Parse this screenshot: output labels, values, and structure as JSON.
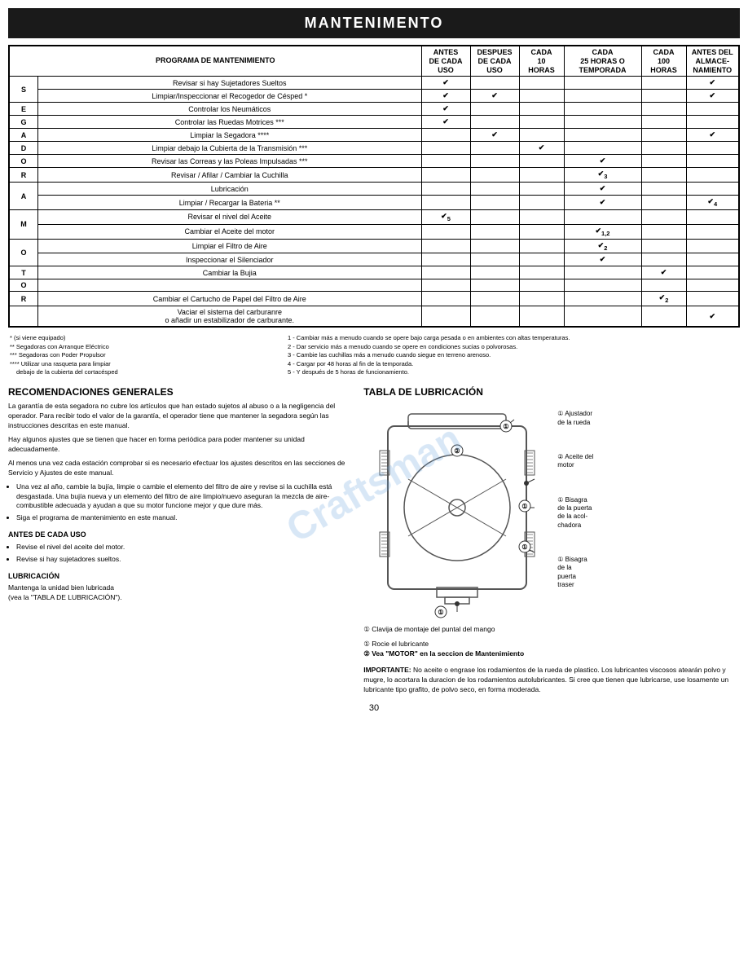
{
  "header": {
    "title": "MANTENIMENTO"
  },
  "table": {
    "program_title": "PROGRAMA DE MANTENIMIENTO",
    "columns": [
      "ANTES\nDE CADA\nUSO",
      "DESPUES\nDE CADA\nUSO",
      "CADA\n10\nHORAS",
      "CADA\n25 HORAS O\nTEMPORADA",
      "CADA\n100\nHORAS",
      "ANTES DEL\nALMACE-\nNAMIENTO"
    ],
    "sections": [
      {
        "letter": "S",
        "rows": [
          {
            "task": "Revisar si hay Sujetadores Sueltos",
            "checks": [
              1,
              0,
              0,
              0,
              0,
              1
            ]
          },
          {
            "task": "Limpiar/Inspeccionar el Recogedor de Césped *",
            "checks": [
              1,
              1,
              0,
              0,
              0,
              1
            ]
          }
        ]
      },
      {
        "letter": "E",
        "rows": [
          {
            "task": "Controlar los Neumáticos",
            "checks": [
              1,
              0,
              0,
              0,
              0,
              0
            ]
          }
        ]
      },
      {
        "letter": "G",
        "rows": [
          {
            "task": "Controlar las Ruedas Motrices ***",
            "checks": [
              1,
              0,
              0,
              0,
              0,
              0
            ]
          }
        ]
      },
      {
        "letter": "A",
        "rows": [
          {
            "task": "Limpiar la Segadora ****",
            "checks": [
              0,
              1,
              0,
              0,
              0,
              1
            ]
          }
        ]
      },
      {
        "letter": "D",
        "rows": [
          {
            "task": "Limpiar debajo la Cubierta de la Transmisión ***",
            "checks": [
              0,
              0,
              1,
              0,
              0,
              0
            ]
          }
        ]
      },
      {
        "letter": "O",
        "rows": [
          {
            "task": "Revisar las Correas y las Poleas Impulsadas ***",
            "checks": [
              0,
              0,
              0,
              1,
              0,
              0
            ]
          }
        ]
      },
      {
        "letter": "R",
        "rows": [
          {
            "task": "Revisar / Afilar / Cambiar la Cuchilla",
            "checks": [
              0,
              0,
              0,
              "✔3",
              0,
              0
            ]
          }
        ]
      },
      {
        "letter": "A",
        "rows": [
          {
            "task": "Lubricación",
            "checks": [
              0,
              0,
              0,
              1,
              0,
              0
            ]
          },
          {
            "task": "Limpiar / Recargar la Bateria **",
            "checks": [
              0,
              0,
              0,
              1,
              0,
              "✔4"
            ]
          }
        ]
      },
      {
        "letter": "M",
        "rows": [
          {
            "task": "Revisar el nivel del Aceite",
            "checks": [
              "✔5",
              0,
              0,
              0,
              0,
              0
            ]
          },
          {
            "task": "Cambiar el Aceite del motor",
            "checks": [
              0,
              0,
              0,
              "✔1,2",
              0,
              0
            ]
          }
        ]
      },
      {
        "letter": "O",
        "rows": [
          {
            "task": "Limpiar el Filtro de Aire",
            "checks": [
              0,
              0,
              0,
              "✔2",
              0,
              0
            ]
          },
          {
            "task": "Inspeccionar el Silenciador",
            "checks": [
              0,
              0,
              0,
              1,
              0,
              0
            ]
          }
        ]
      },
      {
        "letter": "T",
        "rows": [
          {
            "task": "Cambiar la Bujia",
            "checks": [
              0,
              0,
              0,
              0,
              1,
              0
            ]
          }
        ]
      },
      {
        "letter": "O",
        "rows": []
      },
      {
        "letter": "R",
        "rows": [
          {
            "task": "Cambiar el Cartucho de Papel del Filtro de Aire",
            "checks": [
              0,
              0,
              0,
              0,
              "✔2",
              0
            ]
          }
        ]
      },
      {
        "letter": "",
        "rows": [
          {
            "task": "Vaciar el sistema del carburanre\no añadir un estabilizador de carburante.",
            "checks": [
              0,
              0,
              0,
              0,
              0,
              1
            ]
          }
        ]
      }
    ]
  },
  "footnotes": {
    "left": [
      "* (si viene equipado)",
      "** Segadoras con Arranque Eléctrico",
      "*** Segadoras con Poder Propulsor",
      "**** Utilizar una rasqueta para limpiar",
      "     debajo de la cubierta del cortacésped"
    ],
    "right": [
      "1 - Cambiar más a menudo cuando se opere bajo carga pesada o en ambientes con altas temperaturas.",
      "2 - Dar servicio más a menudo cuando se opere en condiciones sucias o polvorosas.",
      "3 - Cambie las cuchillas más a menudo cuando siegue en terreno arenoso.",
      "4 - Cargar por 48 horas al fin de la temporada.",
      "5 - Y después de 5 horas de funcionamiento."
    ]
  },
  "recomendaciones": {
    "title": "RECOMENDACIONES GENERALES",
    "paragraphs": [
      "La garantía de esta segadora no cubre los artículos que han estado sujetos al abuso o a la negligencia del operador. Para recibir todo el valor de la garantía, el operador tiene que mantener la segadora según las instrucciones descritas en este manual.",
      "Hay algunos ajustes que se tienen que hacer en forma periódica para poder mantener su unidad adecuadamente.",
      "Al menos una vez cada estación comprobar si es necesario efectuar los ajustes descritos en las secciones de Servicio y Ajustes de este manual."
    ],
    "bullets": [
      "Una vez al año, cambie la bujía, limpie o cambie el elemento del filtro de aire y revise si la cuchilla está desgastada. Una bujía nueva y un elemento del filtro de aire limpio/nuevo aseguran la mezcla de aire-combustible adecuada y ayudan a que su motor funcione mejor y que dure más.",
      "Siga el programa de mantenimiento en este manual."
    ],
    "antes_title": "ANTES DE CADA USO",
    "antes_bullets": [
      "Revise el nivel del aceite del motor.",
      "Revise si hay sujetadores sueltos."
    ],
    "lubricacion_title": "LUBRICACIÓN",
    "lubricacion_text": "Mantenga la unidad bien lubricada\n(vea la \"TABLA DE LUBRICACIÓN\")."
  },
  "tabla_lubricacion": {
    "title": "TABLA DE LUBRICACIÓN",
    "labels": [
      {
        "num": "①",
        "text": "Ajustador\nde la rueda"
      },
      {
        "num": "②",
        "text": "Aceite del\nmotor"
      },
      {
        "num": "①",
        "text": "Bisagra\nde la puerta\nde la acol-\nchadora"
      },
      {
        "num": "①",
        "text": "Bisagra\nde la\npuerta\ntraser"
      }
    ],
    "bottom_label": "① Clavija de montaje del puntal del mango",
    "notes": [
      "① Rocie el lubricante",
      "② Vea \"MOTOR\" en la seccion de Mantenimiento"
    ],
    "importante": "IMPORTANTE: No aceite o engrase los rodamientos de la rueda de plastico. Los lubricantes viscosos atearán polvo y mugre, lo acortara la duracion de los rodamientos autolubricantes. Si cree que tienen que lubricarse, use losamente un lubricante tipo grafito, de polvo seco, en forma moderada."
  },
  "page_number": "30",
  "watermark": "Craftsman"
}
